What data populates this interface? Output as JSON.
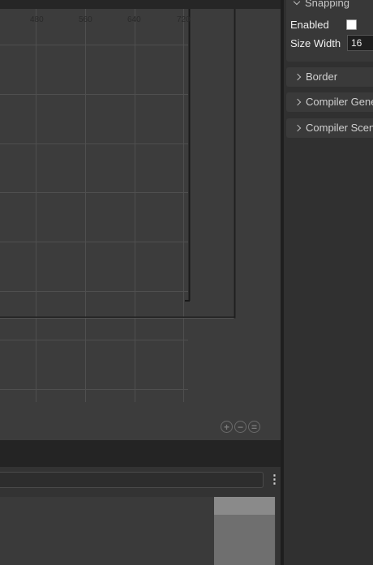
{
  "canvas": {
    "ruler_labels": [
      "480",
      "560",
      "640",
      "720"
    ],
    "zoom_tools": [
      "zoom-in-icon",
      "zoom-out-icon",
      "zoom-reset-icon"
    ]
  },
  "bottom_panel": {
    "search_value": "",
    "menu_icon": "kebab-menu-icon"
  },
  "inspector": {
    "snapping": {
      "title": "Snapping",
      "enabled_label": "Enabled",
      "enabled_checked": false,
      "size_width_label": "Size Width",
      "size_width_value": "16"
    },
    "sections": [
      {
        "label": "Border"
      },
      {
        "label": "Compiler General"
      },
      {
        "label": "Compiler Scene"
      }
    ]
  },
  "colors": {
    "canvas_bg": "#3c3c3c",
    "grid_line": "#4e4e4e",
    "panel_bg": "#303030"
  }
}
